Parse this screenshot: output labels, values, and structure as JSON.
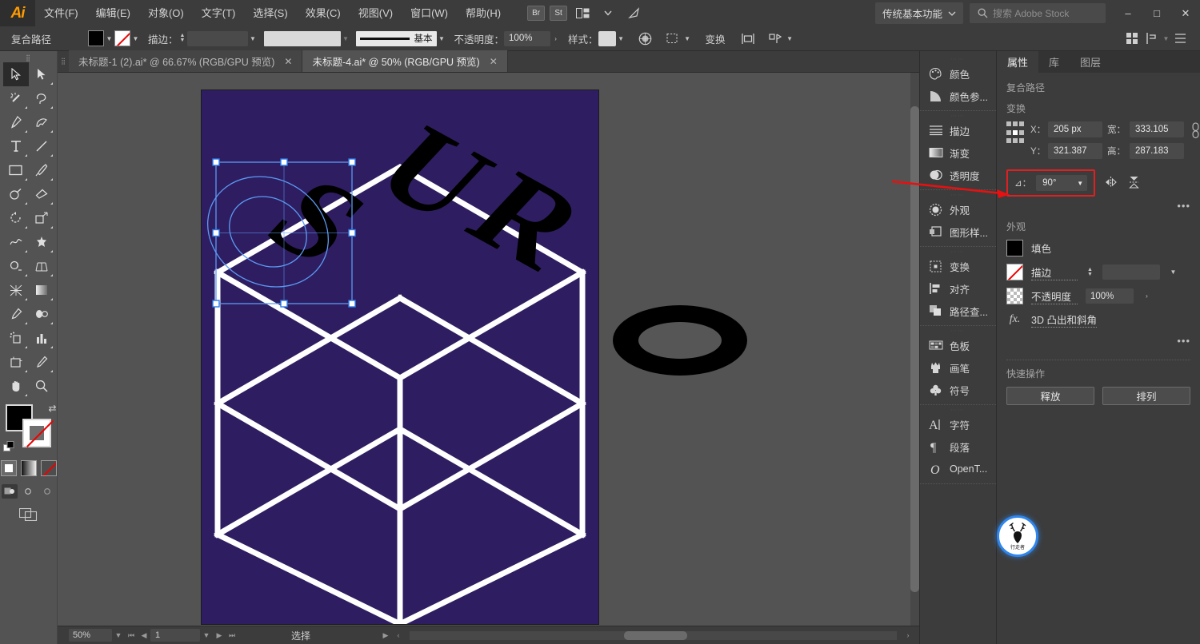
{
  "app": {
    "name": "Adobe Illustrator",
    "logo": "Ai"
  },
  "menubar": {
    "items": [
      {
        "label": "文件(F)"
      },
      {
        "label": "编辑(E)"
      },
      {
        "label": "对象(O)"
      },
      {
        "label": "文字(T)"
      },
      {
        "label": "选择(S)"
      },
      {
        "label": "效果(C)"
      },
      {
        "label": "视图(V)"
      },
      {
        "label": "窗口(W)"
      },
      {
        "label": "帮助(H)"
      }
    ],
    "bridge_label": "Br",
    "stock_label": "St",
    "arrange_icon": "arrange-documents-icon",
    "workspace": "传统基本功能",
    "search_placeholder": "搜索 Adobe Stock",
    "window_minimize": "–",
    "window_maximize": "□",
    "window_close": "✕"
  },
  "optionsbar": {
    "object_type": "复合路径",
    "fill_swatch_color": "#000000",
    "stroke_swatch": "none",
    "stroke_label": "描边：",
    "stroke_weight": "",
    "stroke_profile": "",
    "brush_label": "基本",
    "opacity_label": "不透明度：",
    "opacity_value": "100%",
    "style_label": "样式：",
    "recolor_icon": "recolor-artwork-icon",
    "select_similar_icon": "select-similar-icon",
    "transform_label": "变换",
    "align_icon": "align-icon",
    "distribute_icon": "distribute-icon",
    "right_icons": [
      "arrange-icon",
      "align-panel-icon",
      "options-menu-icon"
    ]
  },
  "toolbar": {
    "tools": [
      "selection-tool",
      "direct-selection-tool",
      "magic-wand-tool",
      "lasso-tool",
      "pen-tool",
      "curvature-tool",
      "type-tool",
      "line-segment-tool",
      "rectangle-tool",
      "paintbrush-tool",
      "shaper-tool",
      "eraser-tool",
      "rotate-tool",
      "scale-tool",
      "width-tool",
      "free-transform-tool",
      "shape-builder-tool",
      "perspective-grid-tool",
      "mesh-tool",
      "gradient-tool",
      "eyedropper-tool",
      "blend-tool",
      "symbol-sprayer-tool",
      "column-graph-tool",
      "artboard-tool",
      "slice-tool",
      "hand-tool",
      "zoom-tool"
    ],
    "selected_tool": "selection-tool",
    "fill_color": "#000000",
    "stroke_color": "none",
    "color_modes": [
      "color-mode",
      "gradient-mode",
      "none-mode"
    ],
    "draw_modes": [
      "draw-normal",
      "draw-behind",
      "draw-inside"
    ],
    "screen_mode": "change-screen-mode"
  },
  "tabs": [
    {
      "title": "未标题-1 (2).ai* @ 66.67% (RGB/GPU 预览)",
      "active": false,
      "close": "✕"
    },
    {
      "title": "未标题-4.ai* @ 50% (RGB/GPU 预览)",
      "active": true,
      "close": "✕"
    }
  ],
  "canvas": {
    "artboard_bg": "#2e1d60",
    "line_color": "#ffffff",
    "letters": [
      "S",
      "U",
      "R",
      "O"
    ],
    "selection_color": "#4a8ff0",
    "outside_shape": "ellipse-o"
  },
  "statusbar": {
    "zoom": "50%",
    "page": "1",
    "status_text": "选择",
    "nav_first": "⏮",
    "nav_prev": "◀",
    "nav_next": "▶",
    "nav_last": "⏭"
  },
  "icondock": {
    "groups": [
      {
        "items": [
          {
            "icon": "color-palette-icon",
            "label": "颜色"
          },
          {
            "icon": "color-guide-icon",
            "label": "颜色参..."
          }
        ]
      },
      {
        "items": [
          {
            "icon": "stroke-icon",
            "label": "描边"
          },
          {
            "icon": "gradient-icon",
            "label": "渐变"
          },
          {
            "icon": "transparency-icon",
            "label": "透明度"
          }
        ]
      },
      {
        "items": [
          {
            "icon": "appearance-icon",
            "label": "外观"
          },
          {
            "icon": "graphic-styles-icon",
            "label": "图形样..."
          }
        ]
      },
      {
        "items": [
          {
            "icon": "transform-icon",
            "label": "变换"
          },
          {
            "icon": "align-icon",
            "label": "对齐"
          },
          {
            "icon": "pathfinder-icon",
            "label": "路径查..."
          }
        ]
      },
      {
        "items": [
          {
            "icon": "swatches-icon",
            "label": "色板"
          },
          {
            "icon": "brushes-icon",
            "label": "画笔"
          },
          {
            "icon": "symbols-icon",
            "label": "符号"
          }
        ]
      },
      {
        "items": [
          {
            "icon": "character-icon",
            "label": "字符"
          },
          {
            "icon": "paragraph-icon",
            "label": "段落"
          },
          {
            "icon": "opentype-icon",
            "label": "OpenT..."
          }
        ]
      }
    ]
  },
  "properties": {
    "tabs": [
      {
        "label": "属性",
        "active": true
      },
      {
        "label": "库",
        "active": false
      },
      {
        "label": "图层",
        "active": false
      }
    ],
    "object_type": "复合路径",
    "transform": {
      "title": "变换",
      "x_label": "X：",
      "x_value": "205 px",
      "y_label": "Y：",
      "y_value": "321.387",
      "w_label": "宽：",
      "w_value": "333.105",
      "h_label": "高：",
      "h_value": "287.183",
      "link_icon": "constrain-proportions-icon",
      "angle_label": "⊿：",
      "angle_value": "90°",
      "angle_highlight_color": "#e02020",
      "flip_h_icon": "flip-horizontal-icon",
      "flip_v_icon": "flip-vertical-icon",
      "more_options": "•••"
    },
    "appearance": {
      "title": "外观",
      "fill_label": "填色",
      "fill_color": "#000000",
      "stroke_label": "描边",
      "stroke_value": "",
      "opacity_label": "不透明度",
      "opacity_value": "100%",
      "fx_label": "fx.",
      "effect_name": "3D 凸出和斜角",
      "more_options": "•••"
    },
    "quick_actions": {
      "title": "快速操作",
      "buttons": [
        {
          "label": "释放"
        },
        {
          "label": "排列"
        }
      ]
    }
  },
  "watermark": {
    "icon": "deer-logo-icon",
    "text": "行走者"
  }
}
